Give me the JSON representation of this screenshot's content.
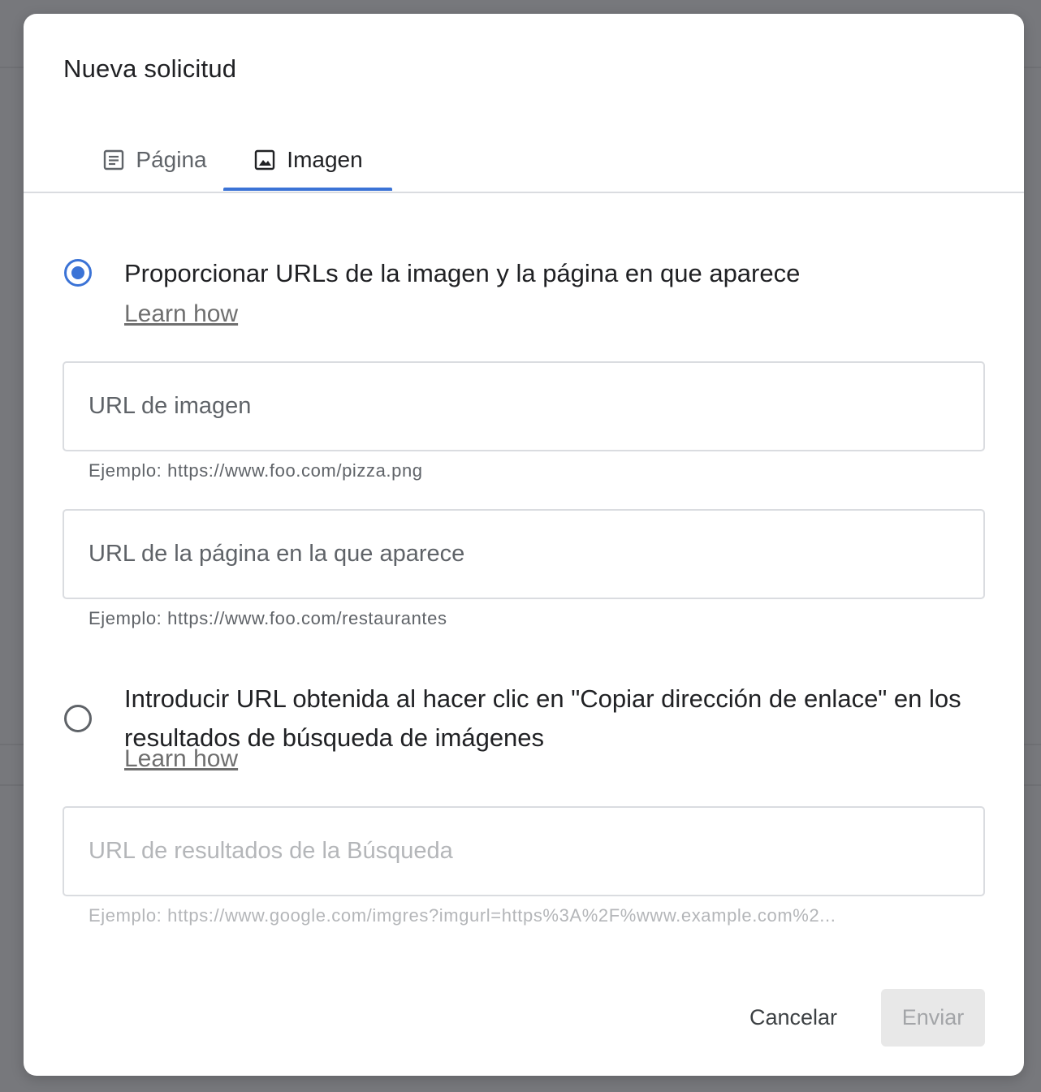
{
  "dialog": {
    "title": "Nueva solicitud"
  },
  "tabs": [
    {
      "label": "Página",
      "icon": "document-icon",
      "selected": false
    },
    {
      "label": "Imagen",
      "icon": "image-icon",
      "selected": true
    }
  ],
  "colors": {
    "accent": "#3b73d6",
    "scrim": "#77787c",
    "text_primary": "#202124",
    "text_secondary": "#5f6368",
    "disabled_text": "#b4b6b9"
  },
  "option_urls": {
    "label": "Proporcionar URLs de la imagen y la página en que aparece",
    "learn_how": "Learn how",
    "selected": true,
    "image_url": {
      "placeholder": "URL de imagen",
      "value": "",
      "hint": "Ejemplo: https://www.foo.com/pizza.png"
    },
    "page_url": {
      "placeholder": "URL de la página en la que aparece",
      "value": "",
      "hint": "Ejemplo: https://www.foo.com/restaurantes"
    }
  },
  "option_search": {
    "label": "Introducir URL obtenida al hacer clic en \"Copiar dirección de enlace\" en los resultados de búsqueda de imágenes",
    "learn_how": "Learn how",
    "selected": false,
    "search_url": {
      "placeholder": "URL de resultados de la Búsqueda",
      "value": "",
      "hint": "Ejemplo: https://www.google.com/imgres?imgurl=https%3A%2F%www.example.com%2..."
    }
  },
  "actions": {
    "cancel_label": "Cancelar",
    "submit_label": "Enviar",
    "submit_enabled": false
  }
}
